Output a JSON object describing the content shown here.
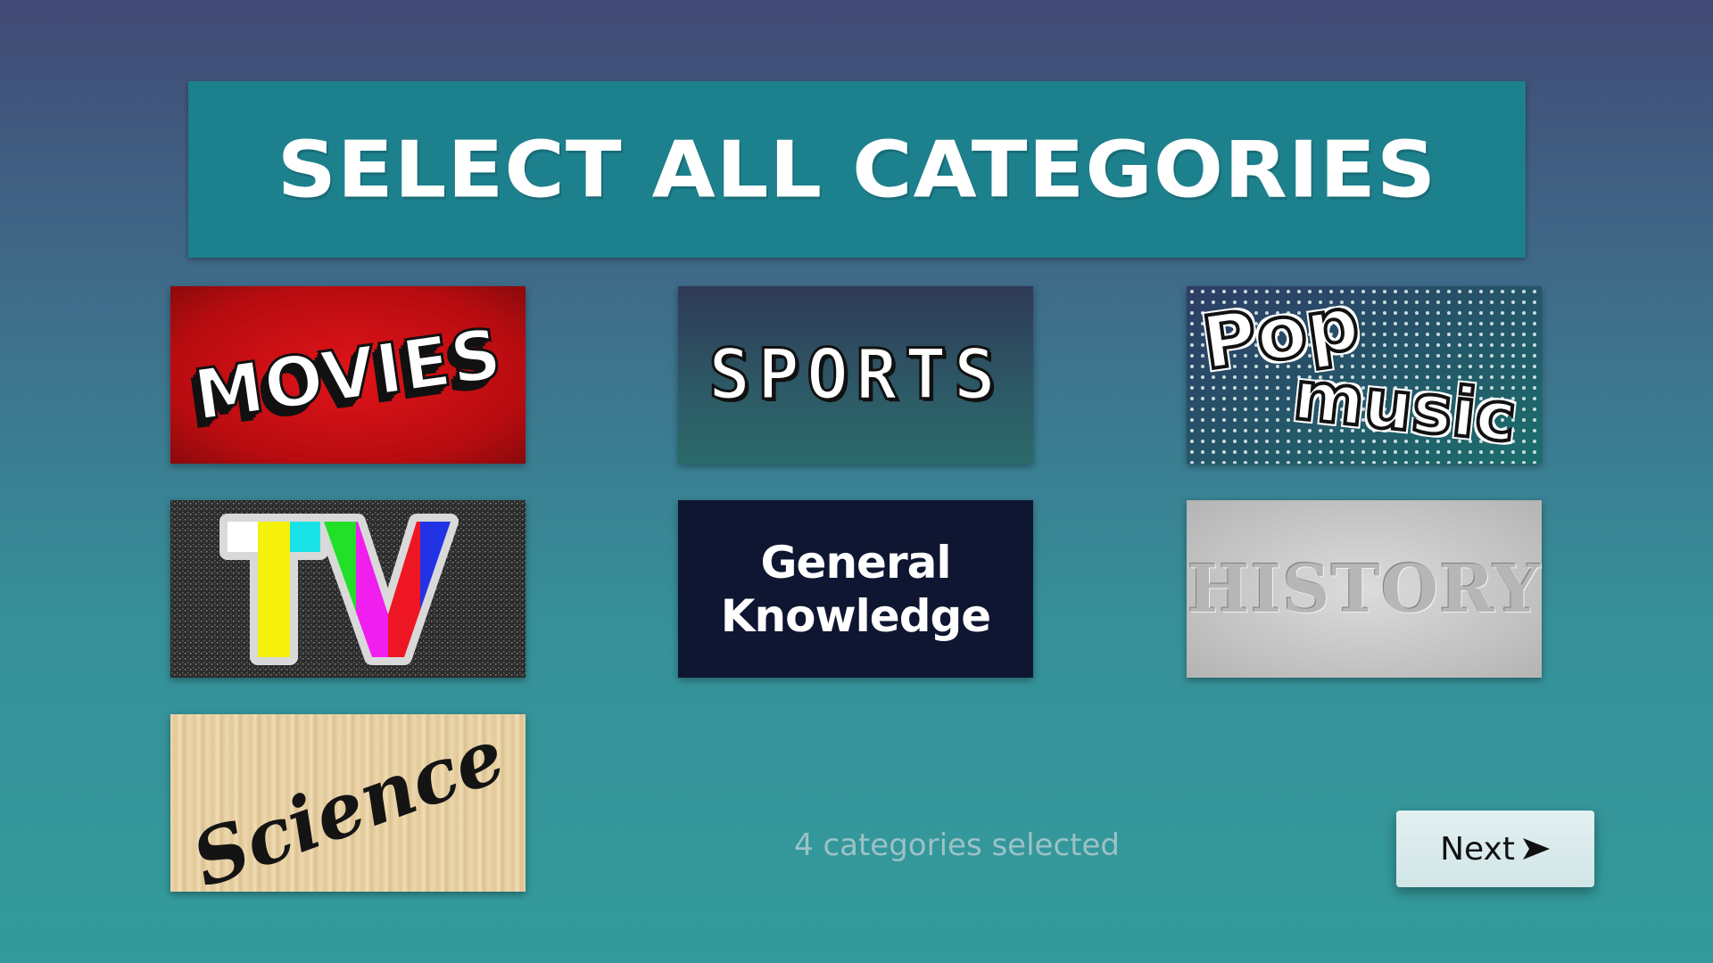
{
  "header": {
    "title": "SELECT ALL CATEGORIES"
  },
  "categories": [
    {
      "id": "movies",
      "label": "MOVIES"
    },
    {
      "id": "sports",
      "label": "SPORTS"
    },
    {
      "id": "pop-music",
      "label_line1": "Pop",
      "label_line2": "music"
    },
    {
      "id": "tv",
      "label": "TV"
    },
    {
      "id": "general-knowledge",
      "label_line1": "General",
      "label_line2": "Knowledge"
    },
    {
      "id": "history",
      "label": "HISTORY"
    },
    {
      "id": "science",
      "label": "Science"
    }
  ],
  "footer": {
    "status_text": "4 categories selected",
    "next_label": "Next",
    "next_icon": "arrow-right-icon"
  },
  "colors": {
    "header_bg": "#1d808d",
    "button_bg": "#d8eaec",
    "status_text": "#9bc2c6"
  }
}
